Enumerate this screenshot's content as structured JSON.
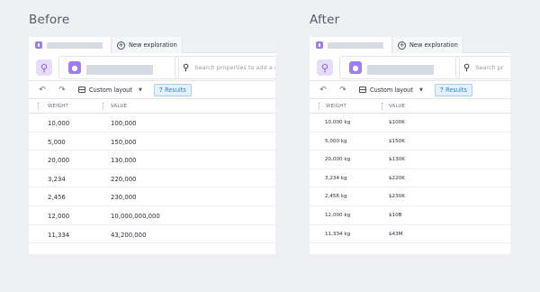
{
  "before": {
    "heading": "Before",
    "new_tab_label": "New exploration",
    "search_placeholder": "Search properties to add a c",
    "layout_label": "Custom layout",
    "results_label": "7 Results",
    "columns": [
      "WEIGHT",
      "VALUE"
    ],
    "rows": [
      [
        "10,000",
        "100,000"
      ],
      [
        "5,000",
        "150,000"
      ],
      [
        "20,000",
        "130,000"
      ],
      [
        "3,234",
        "220,000"
      ],
      [
        "2,456",
        "230,000"
      ],
      [
        "12,000",
        "10,000,000,000"
      ],
      [
        "11,334",
        "43,200,000"
      ]
    ]
  },
  "after": {
    "heading": "After",
    "new_tab_label": "New exploration",
    "search_placeholder": "Search pr",
    "layout_label": "Custom layout",
    "results_label": "7 Results",
    "columns": [
      "WEIGHT",
      "VALUE"
    ],
    "rows": [
      [
        "10,000 kg",
        "$100K"
      ],
      [
        "5,000 kg",
        "$150K"
      ],
      [
        "20,000 kg",
        "$130K"
      ],
      [
        "3,234 kg",
        "$220K"
      ],
      [
        "2,456 kg",
        "$230K"
      ],
      [
        "12,000 kg",
        "$10B"
      ],
      [
        "11,334 kg",
        "$43M"
      ]
    ]
  },
  "icons": {
    "tab": "dataset-icon",
    "new_tab": "plus-circle-icon",
    "explore": "magnifier-icon",
    "scope": "drop-icon",
    "search": "search-icon",
    "undo": "undo-icon",
    "redo": "redo-icon",
    "layout": "layout-icon",
    "dropdown": "caret-down-icon"
  },
  "colors": {
    "accent_purple": "#9c7ef0",
    "results_blue": "#2c7fc8",
    "results_bg": "#e4f1fc"
  }
}
